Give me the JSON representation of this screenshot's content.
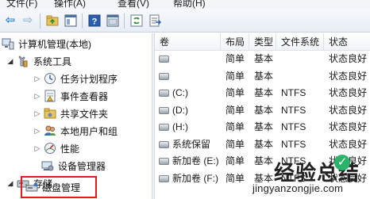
{
  "menu": [
    "文件(F)",
    "操作(A)",
    "查看(V)",
    "帮助(H)"
  ],
  "toolbar": {
    "buttons": [
      "back-arrow-icon",
      "forward-arrow-icon",
      "up-folder-icon",
      "show-hide-tree-icon",
      "help-icon",
      "properties-icon",
      "refresh-icon",
      "export-list-icon"
    ]
  },
  "tree": {
    "root": "计算机管理(本地)",
    "system_tools": "系统工具",
    "task_scheduler": "任务计划程序",
    "event_viewer": "事件查看器",
    "shared_folders": "共享文件夹",
    "local_users": "本地用户和组",
    "performance": "性能",
    "device_manager": "设备管理器",
    "storage": "存储",
    "disk_management": "磁盘管理"
  },
  "columns": [
    "卷",
    "布局",
    "类型",
    "文件系统",
    "状态"
  ],
  "volumes": [
    {
      "name": "",
      "layout": "简单",
      "type": "基本",
      "fs": "",
      "status": "状态良好"
    },
    {
      "name": "",
      "layout": "简单",
      "type": "基本",
      "fs": "",
      "status": "状态良好"
    },
    {
      "name": "(C:)",
      "layout": "简单",
      "type": "基本",
      "fs": "NTFS",
      "status": "状态良好"
    },
    {
      "name": "(D:)",
      "layout": "简单",
      "type": "基本",
      "fs": "NTFS",
      "status": "状态良好"
    },
    {
      "name": "(H:)",
      "layout": "简单",
      "type": "基本",
      "fs": "NTFS",
      "status": "状态良好"
    },
    {
      "name": "系统保留",
      "layout": "简单",
      "type": "基本",
      "fs": "NTFS",
      "status": "状态良好"
    },
    {
      "name": "新加卷 (E:)",
      "layout": "简单",
      "type": "基本",
      "fs": "NTFS",
      "status": "状态良好"
    },
    {
      "name": "新加卷 (F:)",
      "layout": "简单",
      "type": "基本",
      "fs": "NTFS",
      "status": "状态良好"
    }
  ],
  "watermark": {
    "logo": "经验总结",
    "url": "jingyanzongjie.com"
  },
  "colors": {
    "highlight": "#e51b1b",
    "accent": "#3a78c8"
  }
}
